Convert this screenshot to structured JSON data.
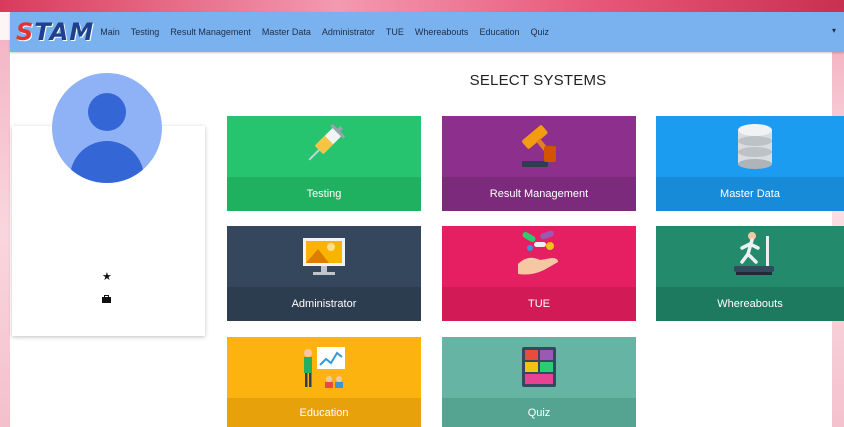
{
  "brand": {
    "logo_text": "STAM",
    "logo_first_letter": "S",
    "logo_rest": "TAM"
  },
  "nav": {
    "items": [
      "Main",
      "Testing",
      "Result Management",
      "Master Data",
      "Administrator",
      "TUE",
      "Whereabouts",
      "Education",
      "Quiz"
    ],
    "caret": "▾"
  },
  "profile": {
    "avatar_icon": "user-avatar-icon",
    "star_glyph": "★",
    "star_icon": "star-icon",
    "briefcase_icon": "briefcase-icon"
  },
  "page": {
    "title": "SELECT SYSTEMS"
  },
  "systems": [
    {
      "label": "Testing",
      "icon": "syringe-icon",
      "color": "#26c46e"
    },
    {
      "label": "Result Management",
      "icon": "gavel-icon",
      "color": "#8d2f8c"
    },
    {
      "label": "Master Data",
      "icon": "database-icon",
      "color": "#1c9cf0"
    },
    {
      "label": "Administrator",
      "icon": "monitor-icon",
      "color": "#35475d"
    },
    {
      "label": "TUE",
      "icon": "pills-hand-icon",
      "color": "#e51f61"
    },
    {
      "label": "Whereabouts",
      "icon": "treadmill-runner-icon",
      "color": "#248a6c"
    },
    {
      "label": "Education",
      "icon": "presentation-icon",
      "color": "#fdb30f"
    },
    {
      "label": "Quiz",
      "icon": "quiz-board-icon",
      "color": "#66b5a4"
    }
  ]
}
